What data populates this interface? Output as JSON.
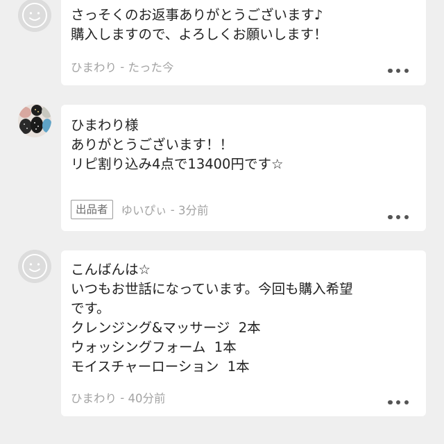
{
  "comments": [
    {
      "lines": [
        "さっそくのお返事ありがとうございます♪",
        "購入しますので、よろしくお願いします！"
      ],
      "author": "ひまわり",
      "separator": " - ",
      "time": "たった今",
      "avatar_icon": "default-face-icon",
      "more_icon": "more-dots-icon"
    },
    {
      "lines": [
        "ひまわり様",
        "ありがとうございます！！",
        "リピ割り込み4点で13400円です☆"
      ],
      "badge": "出品者",
      "author": "ゆいぴぃ",
      "separator": " - ",
      "time": "3分前",
      "avatar_icon": "seller-photo-avatar",
      "more_icon": "more-dots-icon"
    },
    {
      "lines": [
        "こんばんは☆",
        "いつもお世話になっています。今回も購入希望",
        "です。",
        "クレンジング&マッサージ  2本",
        "ウォッシングフォーム  1本",
        "モイスチャーローション  1本"
      ],
      "author": "ひまわり",
      "separator": " - ",
      "time": "40分前",
      "avatar_icon": "default-face-icon",
      "more_icon": "more-dots-icon"
    }
  ]
}
